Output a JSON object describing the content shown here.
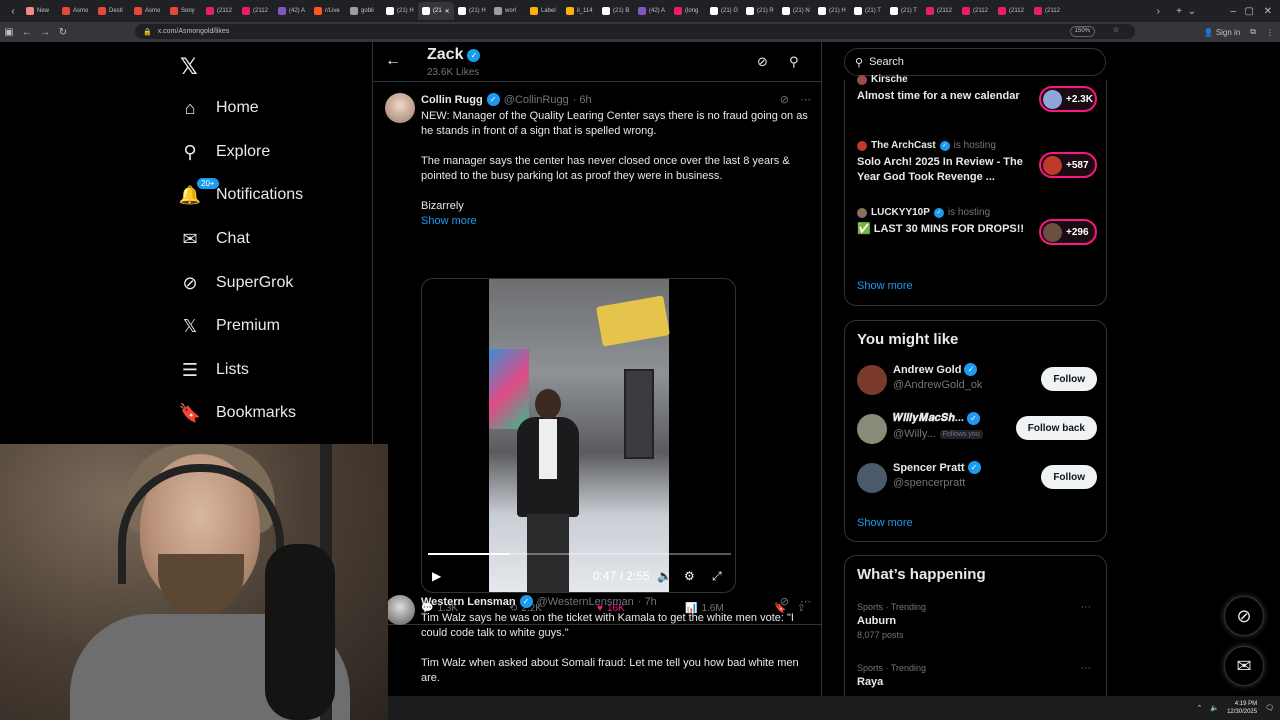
{
  "browser": {
    "tabs": [
      {
        "label": "New",
        "color": "#f28b82"
      },
      {
        "label": "Asmo",
        "color": "#e8453c"
      },
      {
        "label": "Desti",
        "color": "#e8453c"
      },
      {
        "label": "Asmo",
        "color": "#e8453c"
      },
      {
        "label": "Sony",
        "color": "#e8453c"
      },
      {
        "label": "(2112",
        "color": "#e91e63"
      },
      {
        "label": "(2112",
        "color": "#e91e63"
      },
      {
        "label": "(42) A",
        "color": "#7e57c2"
      },
      {
        "label": "r/Live",
        "color": "#ff5722"
      },
      {
        "label": "gobli",
        "color": "#9e9e9e"
      },
      {
        "label": "(21) H",
        "color": "#ffffff"
      },
      {
        "label": "(21",
        "color": "#ffffff"
      },
      {
        "label": "(21) H",
        "color": "#ffffff"
      },
      {
        "label": "worl",
        "color": "#9e9e9e"
      },
      {
        "label": "Label",
        "color": "#ffb300"
      },
      {
        "label": "il_114",
        "color": "#ffb300"
      },
      {
        "label": "(21) B",
        "color": "#ffffff"
      },
      {
        "label": "(42) A",
        "color": "#7e57c2"
      },
      {
        "label": "(long",
        "color": "#e91e63"
      },
      {
        "label": "(21) G",
        "color": "#ffffff"
      },
      {
        "label": "(21) R",
        "color": "#ffffff"
      },
      {
        "label": "(21) N",
        "color": "#ffffff"
      },
      {
        "label": "(21) H",
        "color": "#ffffff"
      },
      {
        "label": "(21) T",
        "color": "#ffffff"
      },
      {
        "label": "(21) T",
        "color": "#ffffff"
      },
      {
        "label": "(2112",
        "color": "#e91e63"
      },
      {
        "label": "(2112",
        "color": "#e91e63"
      },
      {
        "label": "(2112",
        "color": "#e91e63"
      },
      {
        "label": "(2112",
        "color": "#e91e63"
      }
    ],
    "url": "x.com/Asmongold/likes",
    "zoom": "150%",
    "signin": "Sign in"
  },
  "nav": {
    "logo": "𝕏",
    "items": [
      {
        "label": "Home",
        "icon": "⌂"
      },
      {
        "label": "Explore",
        "icon": "⚲"
      },
      {
        "label": "Notifications",
        "icon": "🔔"
      },
      {
        "label": "Chat",
        "icon": "✉"
      },
      {
        "label": "SuperGrok",
        "icon": "⊘"
      },
      {
        "label": "Premium",
        "icon": "𝕏"
      },
      {
        "label": "Lists",
        "icon": "☰"
      },
      {
        "label": "Bookmarks",
        "icon": "🔖"
      }
    ],
    "notif_badge": "20+"
  },
  "profile": {
    "name": "Zack",
    "likes": "23.6K Likes"
  },
  "tweets": [
    {
      "name": "Collin Rugg",
      "handle": "@CollinRugg",
      "time": "· 6h",
      "p1": "NEW: Manager of the Quality Learing Center says there is no fraud going on as he stands in front of a sign that is spelled wrong.",
      "p2": "The manager says the center has never closed once over the last 8 years & pointed to the busy parking lot as proof they were in business.",
      "p3": "Bizarrely",
      "showmore": "Show more",
      "video_time": "0:47 / 2:55",
      "video_progress": 0.27,
      "replies": "1.3K",
      "reposts": "2.2K",
      "likes": "16K",
      "views": "1.6M"
    },
    {
      "name": "Western Lensman",
      "handle": "@WesternLensman",
      "time": "· 7h",
      "p1": "Tim Walz says he was on the ticket with Kamala to get the white men vote: \"I could code talk to white guys.\"",
      "p2": "Tim Walz when asked about Somali fraud: Let me tell you how bad white men are."
    }
  ],
  "search": {
    "placeholder": "Search"
  },
  "spaces": [
    {
      "host": "Kirsche",
      "title": "Almost time for a new calendar",
      "count": "+2.3K"
    },
    {
      "host": "The ArchCast",
      "hosting": "is hosting",
      "title": "Solo Arch! 2025 In Review - The Year God Took Revenge ...",
      "count": "+587"
    },
    {
      "host": "LUCKYY10P",
      "hosting": "is hosting",
      "title": "✅ LAST 30 MINS FOR DROPS!!",
      "count": "+296"
    }
  ],
  "spaces_showmore": "Show more",
  "you_might_like": {
    "title": "You might like",
    "users": [
      {
        "name": "Andrew Gold",
        "handle": "@AndrewGold_ok",
        "button": "Follow",
        "color": "#7a3a2a"
      },
      {
        "name": "𝑾𝒊𝒍𝒍𝒚𝑴𝒂𝒄𝑺𝒉...",
        "handle": "@Willy...",
        "follows_you": "Follows you",
        "button": "Follow back",
        "color": "#8a8a7a"
      },
      {
        "name": "Spencer Pratt",
        "handle": "@spencerpratt",
        "button": "Follow",
        "color": "#4a5a6a"
      }
    ],
    "showmore": "Show more"
  },
  "happening": {
    "title": "What’s happening",
    "trends": [
      {
        "category": "Sports · Trending",
        "name": "Auburn",
        "count": "8,077 posts"
      },
      {
        "category": "Sports · Trending",
        "name": "Raya",
        "count": ""
      }
    ]
  },
  "taskbar": {
    "time": "4:19 PM",
    "date": "12/30/2025"
  }
}
